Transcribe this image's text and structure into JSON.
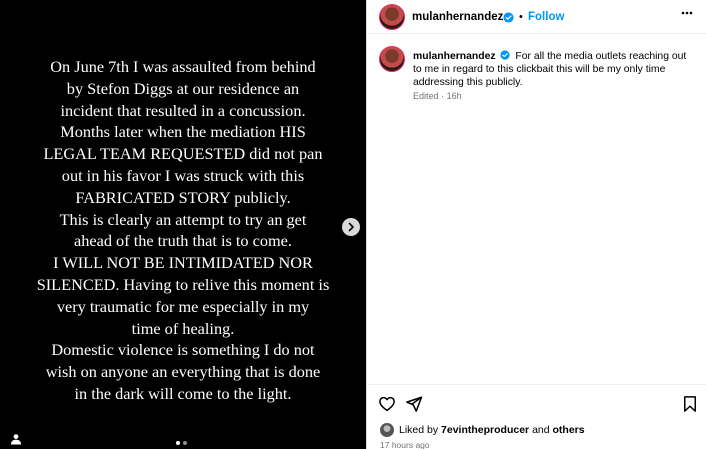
{
  "media": {
    "story_lines": [
      "On June 7th I was assaulted from behind",
      "by Stefon Diggs at our residence an",
      "incident that resulted in a concussion.",
      "Months later when the mediation HIS",
      "LEGAL TEAM REQUESTED did not pan",
      "out in his favor I was struck with this",
      "FABRICATED STORY publicly.",
      "This is clearly an attempt to try an get",
      "ahead of the truth that is to come.",
      "I WILL NOT BE INTIMIDATED NOR",
      "SILENCED. Having to relive this moment is",
      "very traumatic for me especially in my",
      "time of healing.",
      "Domestic violence is something I do not",
      "wish on anyone an everything that is done",
      "in the dark will come to the light."
    ],
    "carousel_total": 2,
    "carousel_active": 1
  },
  "header": {
    "username": "mulanhernandez",
    "separator": "•",
    "follow_label": "Follow"
  },
  "caption": {
    "username": "mulanhernandez",
    "text": "For all the media outlets reaching out to me in regard to this clickbait this will be my only time addressing this publicly.",
    "edited_label": "Edited",
    "meta_sep": "·",
    "age": "16h"
  },
  "footer": {
    "liked_prefix": "Liked by",
    "liked_user": "7evintheproducer",
    "liked_and": "and",
    "liked_others": "others",
    "time_ago": "17 hours ago"
  },
  "colors": {
    "accent": "#0095f6",
    "verified": "#0095f6",
    "muted": "#737373"
  },
  "icons": [
    "chevron-right-icon",
    "user-tag-icon",
    "verified-badge-icon",
    "more-options-icon",
    "heart-icon",
    "share-icon",
    "bookmark-icon"
  ]
}
